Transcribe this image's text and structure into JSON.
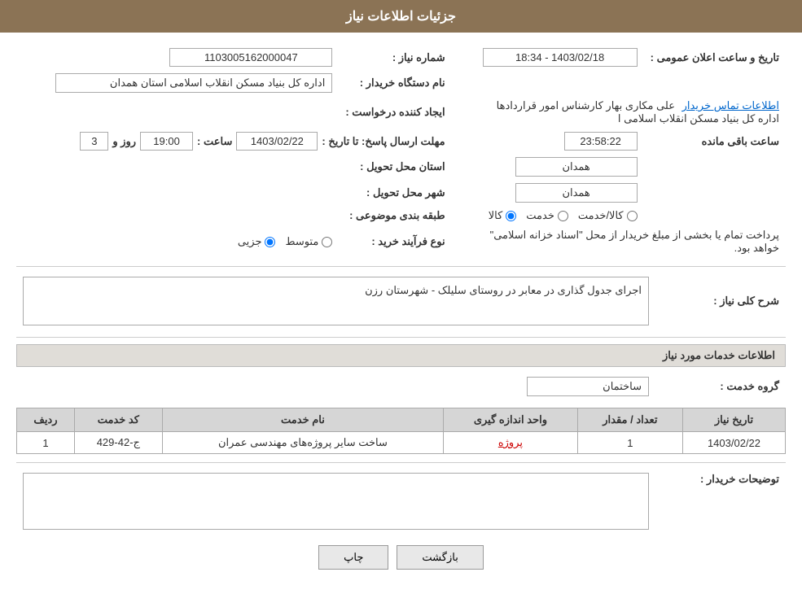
{
  "header": {
    "title": "جزئیات اطلاعات نیاز"
  },
  "fields": {
    "shomara_niaz_label": "شماره نیاز :",
    "shomara_niaz_value": "1103005162000047",
    "daststgah_label": "نام دستگاه خریدار :",
    "daststgah_value": "اداره کل بنیاد مسکن انقلاب اسلامی استان همدان",
    "ijad_konande_label": "ایجاد کننده درخواست :",
    "ijad_konande_value": "علی مکاری بهار کارشناس امور قراردادها اداره کل بنیاد مسکن انقلاب اسلامی ا",
    "ijad_konande_link": "اطلاعات تماس خریدار",
    "mohlat_label": "مهلت ارسال پاسخ: تا تاریخ :",
    "date_value": "1403/02/22",
    "saat_label": "ساعت :",
    "saat_value": "19:00",
    "rooz_label": "روز و",
    "rooz_value": "3",
    "baqi_mande_label": "ساعت باقی مانده",
    "baqi_mande_value": "23:58:22",
    "ostan_label": "استان محل تحویل :",
    "ostan_value": "همدان",
    "shahr_label": "شهر محل تحویل :",
    "shahr_value": "همدان",
    "tabaqe_label": "طبقه بندی موضوعی :",
    "tabaqe_kala": "کالا",
    "tabaqe_khadamat": "خدمت",
    "tabaqe_kala_khadamat": "کالا/خدمت",
    "nooe_farayand_label": "نوع فرآیند خرید :",
    "nooe_jozee": "جزیی",
    "nooe_motavasset": "متوسط",
    "nooe_description": "پرداخت تمام یا بخشی از مبلغ خریدار از محل \"اسناد خزانه اسلامی\" خواهد بود.",
    "tarikh_ilan_label": "تاریخ و ساعت اعلان عمومی :",
    "tarikh_ilan_value": "1403/02/18 - 18:34"
  },
  "sharh_niaz": {
    "label": "شرح کلی نیاز :",
    "value": "اجرای جدول گذاری در معابر در روستای سلیلک - شهرستان رزن"
  },
  "khadamat_section": {
    "title": "اطلاعات خدمات مورد نیاز",
    "grooh_khadamat_label": "گروه خدمت :",
    "grooh_khadamat_value": "ساختمان"
  },
  "table": {
    "headers": [
      "ردیف",
      "کد خدمت",
      "نام خدمت",
      "واحد اندازه گیری",
      "تعداد / مقدار",
      "تاریخ نیاز"
    ],
    "rows": [
      {
        "radif": "1",
        "kod_khadamat": "ج-42-429",
        "nam_khadamat": "ساخت سایر پروژه‌های مهندسی عمران",
        "vahed": "پروژه",
        "tedad": "1",
        "tarikh": "1403/02/22"
      }
    ]
  },
  "tosihات_label": "توضیحات خریدار :",
  "buttons": {
    "print": "چاپ",
    "back": "بازگشت"
  }
}
